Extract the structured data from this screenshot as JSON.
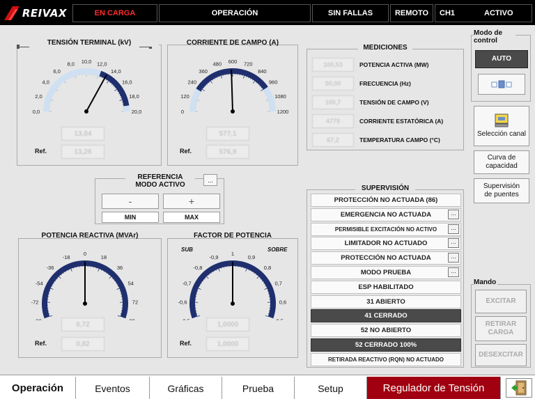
{
  "topbar": {
    "brand": "REIVAX",
    "status_carga": "EN CARGA",
    "status_operacion": "OPERACIÓN",
    "status_fallas": "SIN FALLAS",
    "status_remoto": "REMOTO",
    "status_ch": "CH1",
    "status_activo": "ACTIVO"
  },
  "gauges": {
    "tension": {
      "title": "TENSIÓN TERMINAL (kV)",
      "ticks": [
        "0,0",
        "2,0",
        "4,0",
        "6,0",
        "8,0",
        "10,0",
        "12,0",
        "14,0",
        "16,0",
        "18,0",
        "20,0"
      ],
      "value": "13,04",
      "ref_label": "Ref.",
      "ref": "13,26",
      "needle_fraction": 0.66
    },
    "corriente": {
      "title": "CORRIENTE DE CAMPO (A)",
      "ticks": [
        "0",
        "120",
        "240",
        "360",
        "480",
        "600",
        "720",
        "840",
        "960",
        "1080",
        "1200"
      ],
      "value": "577,1",
      "ref_label": "Ref.",
      "ref": "576,9",
      "needle_fraction": 0.49
    },
    "reactiva": {
      "title": "POTENCIA REACTIVA (MVAr)",
      "ticks": [
        "-90",
        "-72",
        "-54",
        "-36",
        "-18",
        "0",
        "18",
        "36",
        "54",
        "72",
        "90"
      ],
      "value": "0,72",
      "ref_label": "Ref.",
      "ref": "0,82",
      "needle_fraction": 0.5
    },
    "factor": {
      "title": "FACTOR DE POTENCIA",
      "ticks": [
        "-0,5",
        "-0,6",
        "-0,7",
        "-0,8",
        "-0,9",
        "1",
        "0,9",
        "0,8",
        "0,7",
        "0,6",
        "0,5"
      ],
      "sub": "SUB",
      "sobre": "SOBRE",
      "value": "1,0000",
      "ref_label": "Ref.",
      "ref": "1,0000",
      "needle_fraction": 0.5
    }
  },
  "referencia": {
    "title1": "REFERENCIA",
    "title2": "MODO ACTIVO",
    "dots": "...",
    "minus": "-",
    "plus": "+",
    "min": "MIN",
    "max": "MAX"
  },
  "mediciones": {
    "title": "MEDICIONES",
    "rows": [
      {
        "value": "100,53",
        "label": "POTENCIA ACTIVA (MW)"
      },
      {
        "value": "50,00",
        "label": "FRECUENCIA (Hz)"
      },
      {
        "value": "100,7",
        "label": "TENSIÓN DE CAMPO (V)"
      },
      {
        "value": "4775",
        "label": "CORRIENTE ESTATÓRICA (A)"
      },
      {
        "value": "67,2",
        "label": "TEMPERATURA CAMPO (°C)"
      }
    ]
  },
  "supervision": {
    "title": "SUPERVISIÓN",
    "dots": "...",
    "rows": [
      "PROTECCIÓN NO ACTUADA (86)",
      "EMERGENCIA NO ACTUADA",
      "PERMISIBLE EXCITACIÓN NO ACTIVO",
      "LIMITADOR NO ACTUADO",
      "PROTECCIÓN NO ACTUADA",
      "MODO PRUEBA",
      "ESP HABILITADO",
      "31 ABIERTO",
      "41 CERRADO",
      "52 NO ABIERTO",
      "52 CERRADO 100%",
      "RETIRADA REACTIVO (RQN) NO ACTUADO"
    ]
  },
  "modo_control": {
    "title": "Modo de control",
    "auto": "AUTO"
  },
  "right_buttons": {
    "seleccion": "Selección canal",
    "curva": "Curva de capacidad",
    "supervision_puentes": "Supervisión de puentes"
  },
  "mando": {
    "title": "Mando",
    "excitar": "EXCITAR",
    "retirar": "RETIRAR CARGA",
    "desexcitar": "DESEXCITAR"
  },
  "tabs": [
    "Operación",
    "Eventos",
    "Gráficas",
    "Prueba",
    "Setup",
    "Regulador de Tensión"
  ],
  "colors": {
    "accent": "#a0000f",
    "gauge_blue": "#1f2f6e",
    "status_red": "#ff2b2b"
  }
}
